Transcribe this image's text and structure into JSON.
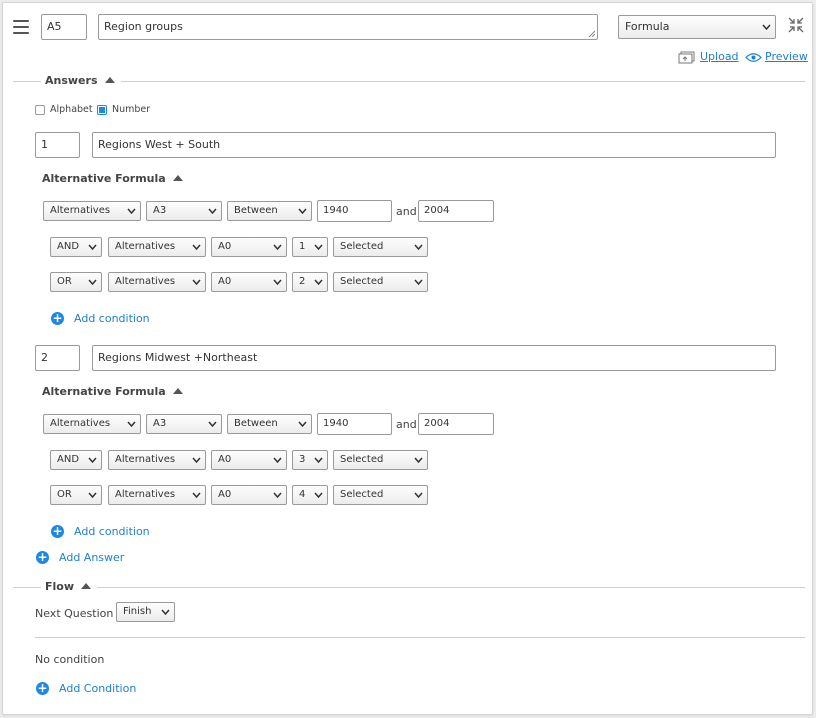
{
  "question": {
    "code": "A5",
    "title": "Region groups",
    "type": "Formula",
    "upload_label": "Upload",
    "preview_label": "Preview"
  },
  "answers_section": {
    "title": "Answers",
    "numbering": [
      {
        "label": "Alphabet",
        "checked": false
      },
      {
        "label": "Number",
        "checked": true
      }
    ],
    "items": [
      {
        "number": "1",
        "label": "Regions West + South",
        "formula_title": "Alternative Formula",
        "first": {
          "source": "Alternatives",
          "question": "A3",
          "operator": "Between",
          "from": "1940",
          "and_label": "and",
          "to": "2004"
        },
        "conditions": [
          {
            "logic": "AND",
            "source": "Alternatives",
            "question": "A0",
            "value": "1",
            "state": "Selected"
          },
          {
            "logic": "OR",
            "source": "Alternatives",
            "question": "A0",
            "value": "2",
            "state": "Selected"
          }
        ],
        "add_condition_label": "Add condition"
      },
      {
        "number": "2",
        "label": "Regions Midwest +Northeast",
        "formula_title": "Alternative Formula",
        "first": {
          "source": "Alternatives",
          "question": "A3",
          "operator": "Between",
          "from": "1940",
          "and_label": "and",
          "to": "2004"
        },
        "conditions": [
          {
            "logic": "AND",
            "source": "Alternatives",
            "question": "A0",
            "value": "3",
            "state": "Selected"
          },
          {
            "logic": "OR",
            "source": "Alternatives",
            "question": "A0",
            "value": "4",
            "state": "Selected"
          }
        ],
        "add_condition_label": "Add condition"
      }
    ],
    "add_answer_label": "Add Answer"
  },
  "flow_section": {
    "title": "Flow",
    "next_question_label": "Next Question",
    "next_question_value": "Finish",
    "no_condition_text": "No condition",
    "add_condition_label": "Add Condition"
  },
  "colors": {
    "accent": "#1e88e5",
    "link": "#1e7fd0",
    "border": "#9a9a9a"
  }
}
